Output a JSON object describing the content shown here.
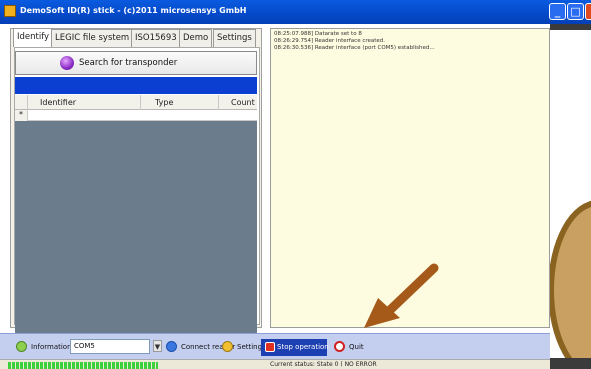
{
  "window": {
    "title": "DemoSoft ID(R) stick - (c)2011 microsensys GmbH",
    "controls": [
      "_",
      "□",
      "×"
    ]
  },
  "tabs": [
    {
      "label": "Identify",
      "active": true
    },
    {
      "label": "LEGIC file system",
      "active": false
    },
    {
      "label": "ISO15693",
      "active": false
    },
    {
      "label": "Demo",
      "active": false
    },
    {
      "label": "Settings",
      "active": false
    }
  ],
  "search_button": {
    "label": "Search for transponder",
    "icon": "magnifier-orb-icon"
  },
  "grid": {
    "columns": [
      "Identifier",
      "Type",
      "Count"
    ],
    "new_row_marker": "*"
  },
  "scrollbar": {
    "left": "◄",
    "right": "►"
  },
  "log": {
    "lines": [
      "08:25:07.988] Datarate set to 8",
      "08:26:29.754] Reader interface created.",
      "08:26:30.536] Reader interface (port COM5) established..."
    ]
  },
  "toolbar": {
    "information_label": "Information",
    "port_value": "COM5",
    "port_arrow": "▼",
    "connect_label": "Connect reader",
    "settings_label": "Settings",
    "stop_label": "Stop operation",
    "quit_label": "Quit"
  },
  "statusbar": {
    "text": "Current status: State 0 ( NO ERROR"
  },
  "colors": {
    "title_bar": "#0549c8",
    "selection_bar": "#0a3fd2",
    "log_background": "#fdfbe0",
    "annotation_arrow": "#a55a1a"
  }
}
